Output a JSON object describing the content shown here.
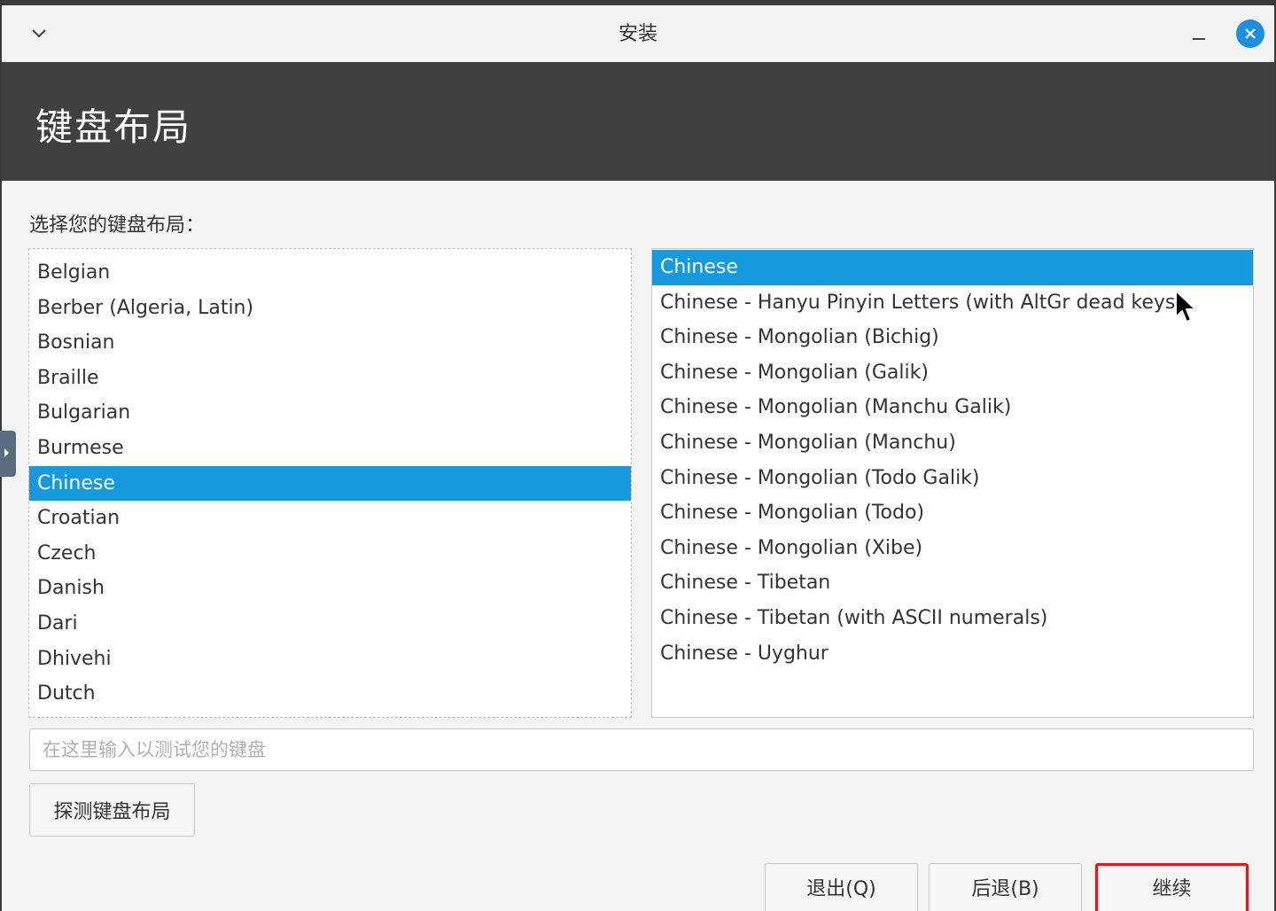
{
  "window": {
    "title": "安装"
  },
  "header": {
    "title": "键盘布局"
  },
  "prompt": "选择您的键盘布局：",
  "layouts": {
    "selected": "Chinese",
    "items": [
      "Belgian",
      "Berber (Algeria, Latin)",
      "Bosnian",
      "Braille",
      "Bulgarian",
      "Burmese",
      "Chinese",
      "Croatian",
      "Czech",
      "Danish",
      "Dari",
      "Dhivehi",
      "Dutch"
    ]
  },
  "variants": {
    "selected": "Chinese",
    "items": [
      "Chinese",
      "Chinese - Hanyu Pinyin Letters (with AltGr dead keys)",
      "Chinese - Mongolian (Bichig)",
      "Chinese - Mongolian (Galik)",
      "Chinese - Mongolian (Manchu Galik)",
      "Chinese - Mongolian (Manchu)",
      "Chinese - Mongolian (Todo Galik)",
      "Chinese - Mongolian (Todo)",
      "Chinese - Mongolian (Xibe)",
      "Chinese - Tibetan",
      "Chinese - Tibetan (with ASCII numerals)",
      "Chinese - Uyghur"
    ]
  },
  "test_input": {
    "placeholder": "在这里输入以测试您的键盘",
    "value": ""
  },
  "buttons": {
    "detect": "探测键盘布局",
    "quit": "退出(Q)",
    "back": "后退(B)",
    "continue": "继续"
  },
  "colors": {
    "selection": "#1799de",
    "header_bg": "#404040",
    "close_button": "#1d8fe0",
    "highlight_border": "#e0191e"
  },
  "icons": {
    "menu": "chevron-down-icon",
    "minimize": "minimize-icon",
    "close": "close-icon",
    "side_handle": "side-panel-handle-icon",
    "cursor": "mouse-pointer-icon"
  }
}
